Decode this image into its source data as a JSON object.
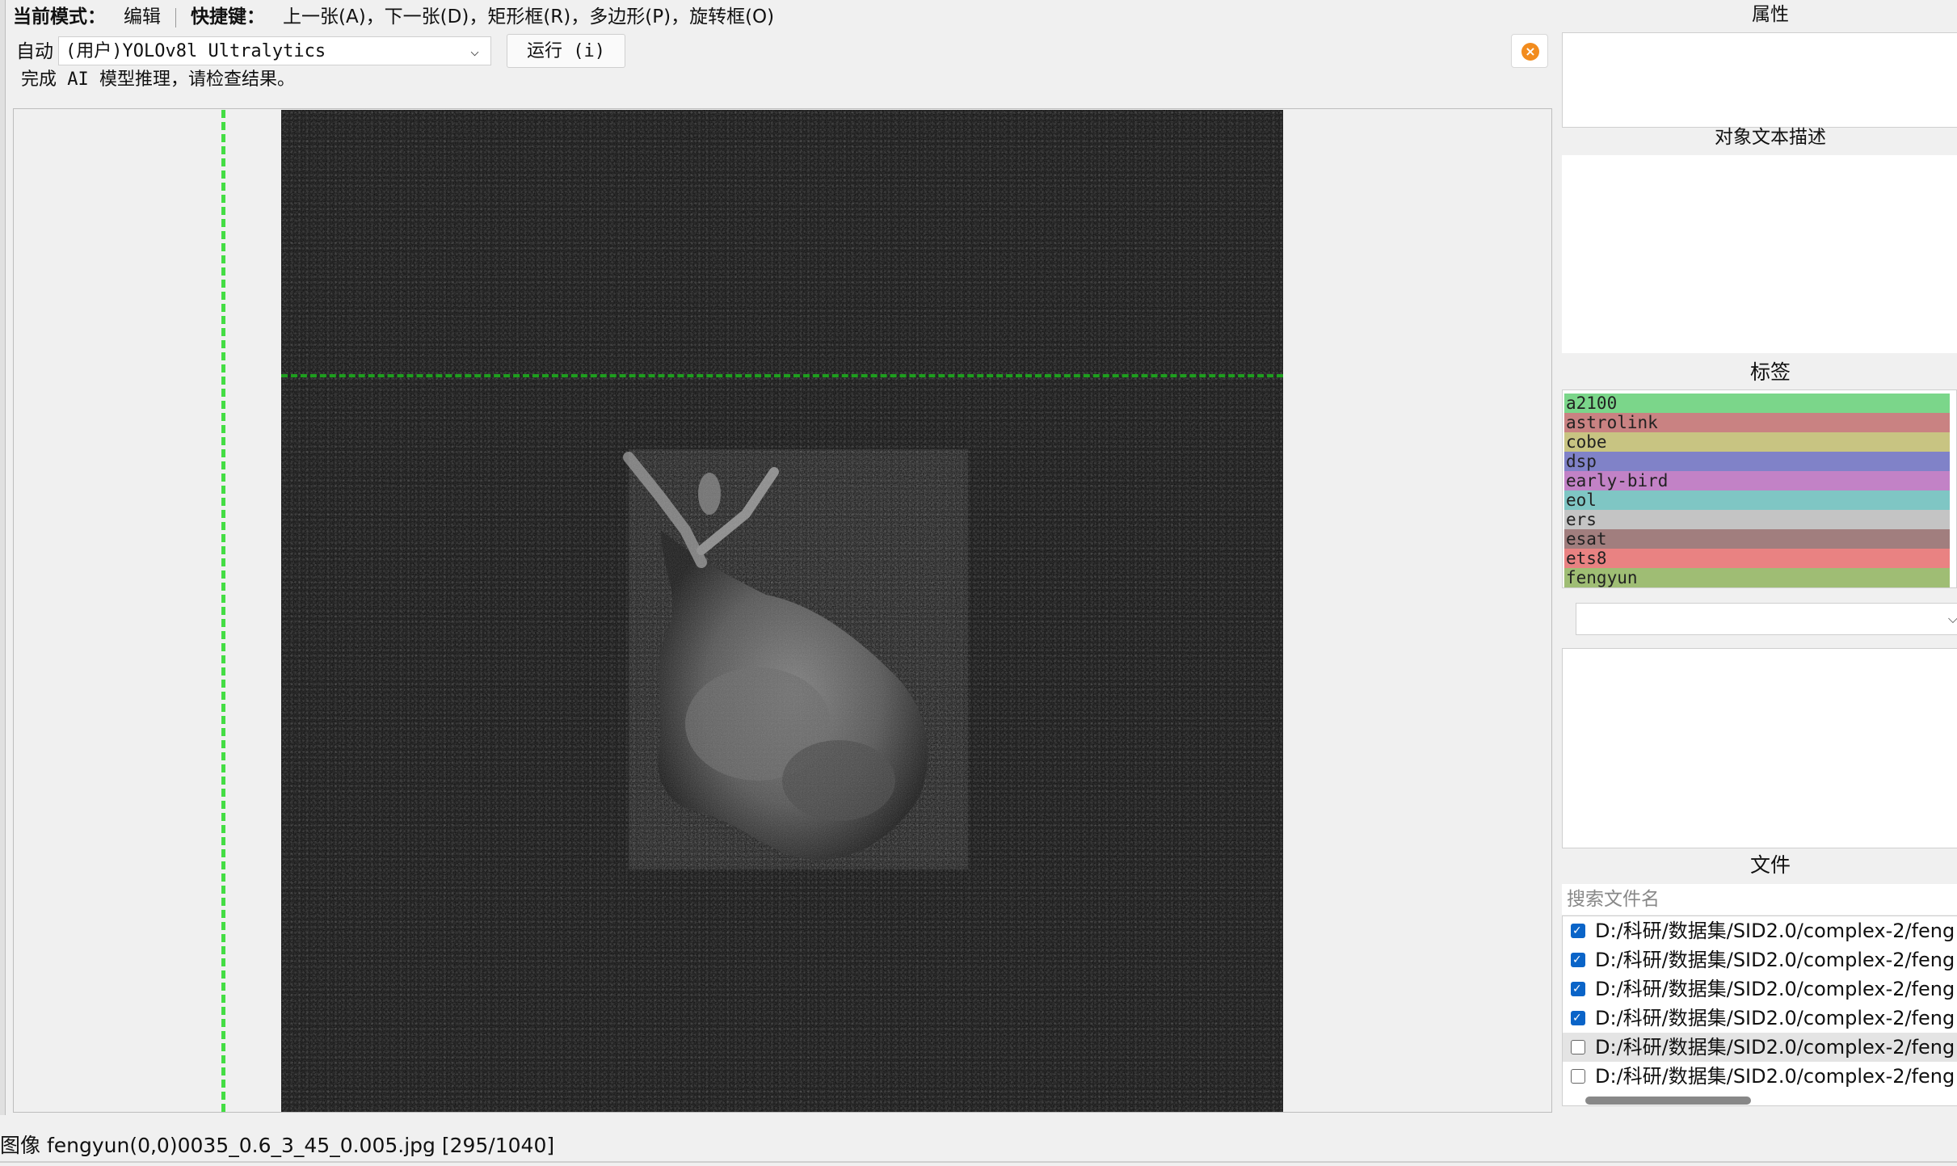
{
  "toolbar": {
    "mode_label": "当前模式：",
    "mode_value": "编辑",
    "shortcut_label": "快捷键：",
    "shortcuts": "上一张(A)，下一张(D)，矩形框(R)，多边形(P)，旋转框(O)"
  },
  "ai": {
    "auto_label": "自动",
    "model": "(用户)YOLOv8l Ultralytics",
    "run_label": "运行 (i)",
    "status": "完成 AI 模型推理，请检查结果。"
  },
  "panels": {
    "properties_title": "属性",
    "description_title": "对象文本描述",
    "labels_title": "标签",
    "files_title": "文件"
  },
  "labels": [
    {
      "name": "a2100",
      "color": "#7bd68a"
    },
    {
      "name": "astrolink",
      "color": "#c98282"
    },
    {
      "name": "cobe",
      "color": "#c8c482"
    },
    {
      "name": "dsp",
      "color": "#8082c8"
    },
    {
      "name": "early-bird",
      "color": "#c282c6"
    },
    {
      "name": "eol",
      "color": "#7fc6c4"
    },
    {
      "name": "ers",
      "color": "#c4c4c4"
    },
    {
      "name": "esat",
      "color": "#a17e7e"
    },
    {
      "name": "ets8",
      "color": "#e98282"
    },
    {
      "name": "fengyun",
      "color": "#9fbd74"
    }
  ],
  "files": {
    "search_placeholder": "搜索文件名",
    "items": [
      {
        "path": "D:/科研/数据集/SID2.0/complex-2/feng",
        "checked": true
      },
      {
        "path": "D:/科研/数据集/SID2.0/complex-2/feng",
        "checked": true
      },
      {
        "path": "D:/科研/数据集/SID2.0/complex-2/feng",
        "checked": true
      },
      {
        "path": "D:/科研/数据集/SID2.0/complex-2/feng",
        "checked": true
      },
      {
        "path": "D:/科研/数据集/SID2.0/complex-2/feng",
        "checked": false
      },
      {
        "path": "D:/科研/数据集/SID2.0/complex-2/feng",
        "checked": false
      }
    ]
  },
  "status_bar": "图像 fengyun(0,0)0035_0.6_3_45_0.005.jpg [295/1040]",
  "colors": {
    "crosshair_vertical": "#44dd44",
    "crosshair_horizontal": "#1e9e1e",
    "checkbox_checked": "#0a64c8",
    "close_button": "#f28c1e"
  }
}
